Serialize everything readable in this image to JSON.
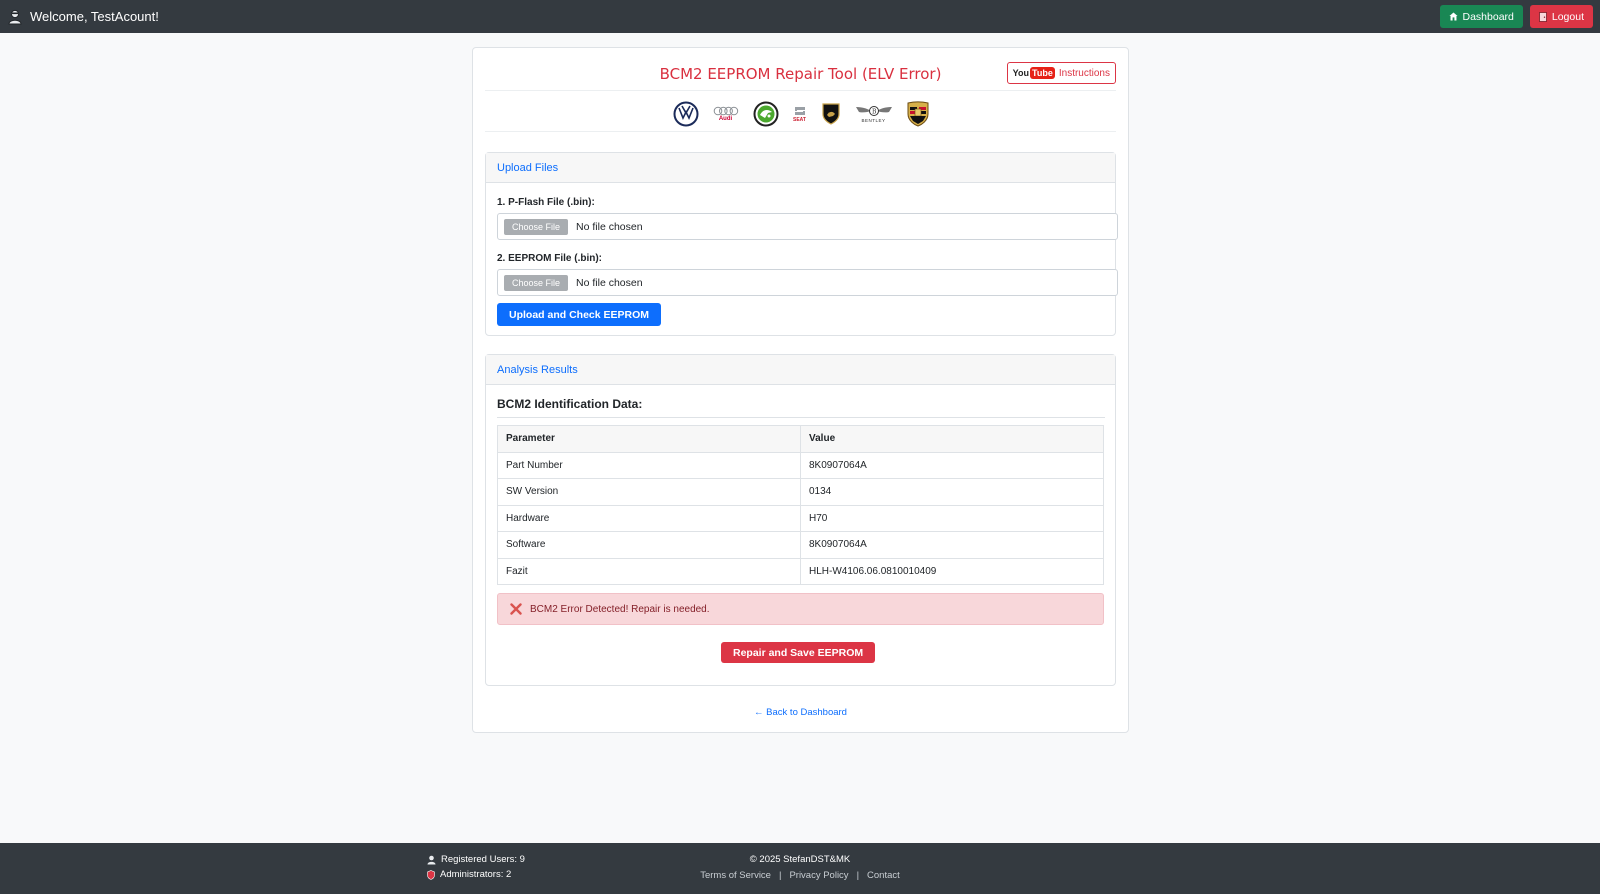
{
  "navbar": {
    "welcome": "Welcome, TestAcount!",
    "dashboard_label": "Dashboard",
    "logout_label": "Logout"
  },
  "main": {
    "title": "BCM2 EEPROM Repair Tool (ELV Error)",
    "instructions": {
      "you": "You",
      "tube": "Tube",
      "label": "Instructions"
    },
    "brands": [
      "Volkswagen",
      "Audi",
      "Skoda",
      "Seat",
      "Lamborghini",
      "Bentley",
      "Porsche"
    ],
    "brand_text": {
      "audi": "Audi",
      "seat": "SEAT",
      "bentley": "BENTLEY"
    }
  },
  "upload": {
    "header": "Upload Files",
    "pflash_label": "1. P-Flash File (.bin):",
    "eeprom_label": "2. EEPROM File (.bin):",
    "choose_label": "Choose File",
    "no_file": "No file chosen",
    "submit_label": "Upload and Check EEPROM"
  },
  "analysis": {
    "header": "Analysis Results",
    "section_title": "BCM2 Identification Data:",
    "columns": [
      "Parameter",
      "Value"
    ],
    "rows": [
      [
        "Part Number",
        "8K0907064A"
      ],
      [
        "SW Version",
        "0134"
      ],
      [
        "Hardware",
        "H70"
      ],
      [
        "Software",
        "8K0907064A"
      ],
      [
        "Fazit",
        "HLH-W4106.06.0810010409"
      ]
    ],
    "alert": "BCM2 Error Detected! Repair is needed.",
    "repair_label": "Repair and Save EEPROM"
  },
  "back_link": "← Back to Dashboard",
  "footer": {
    "registered": "Registered Users: 9",
    "admins": "Administrators: 2",
    "copyright": "© 2025 StefanDST&MK",
    "links": [
      "Terms of Service",
      "Privacy Policy",
      "Contact"
    ],
    "separator": "|"
  },
  "colors": {
    "navbar_bg": "#343a40",
    "primary": "#0d6efd",
    "danger": "#dc3545",
    "success": "#198754",
    "alert_bg": "#f8d7da"
  }
}
